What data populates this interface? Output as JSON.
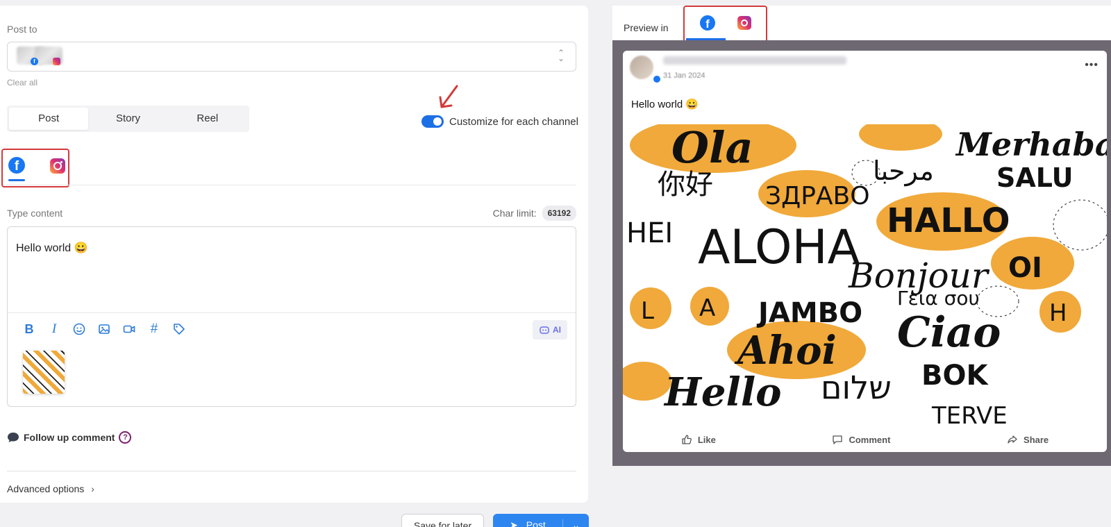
{
  "editor": {
    "post_to_label": "Post to",
    "clear_all": "Clear all",
    "type_tabs": [
      {
        "label": "Post",
        "active": true
      },
      {
        "label": "Story",
        "active": false
      },
      {
        "label": "Reel",
        "active": false
      }
    ],
    "customize_label": "Customize for each channel",
    "customize_enabled": true,
    "type_content_label": "Type content",
    "char_limit_label": "Char limit:",
    "char_limit_value": "63192",
    "content_text": "Hello world 😀",
    "toolbar_icons": [
      "bold-icon",
      "italic-icon",
      "emoji-icon",
      "image-icon",
      "video-icon",
      "hashtag-icon",
      "tag-icon"
    ],
    "ai_label": "AI",
    "follow_up_label": "Follow up comment",
    "advanced_label": "Advanced options",
    "save_label": "Save for later",
    "post_label": "Post"
  },
  "preview": {
    "label": "Preview in",
    "date": "31 Jan 2024",
    "post_text": "Hello world 😀",
    "actions": [
      {
        "label": "Like",
        "icon": "like-icon"
      },
      {
        "label": "Comment",
        "icon": "comment-icon"
      },
      {
        "label": "Share",
        "icon": "share-icon"
      }
    ],
    "image_words": [
      "Ola",
      "Merhaba",
      "SALU",
      "你好",
      "ЗДРАВО",
      "مرحبا",
      "HEI",
      "ALOHA",
      "HALLO",
      "Bonjour",
      "OI",
      "L",
      "A",
      "JAMBO",
      "Γεια σου",
      "H",
      "Ahoi",
      "Ciao",
      "Hello",
      "שלום",
      "BOK",
      "TERVE"
    ]
  },
  "colors": {
    "accent": "#1d6fe6",
    "facebook": "#1877f2",
    "annotation_red": "#d33a3a",
    "preview_bg": "#6e6872",
    "image_orange": "#f0a93a"
  }
}
